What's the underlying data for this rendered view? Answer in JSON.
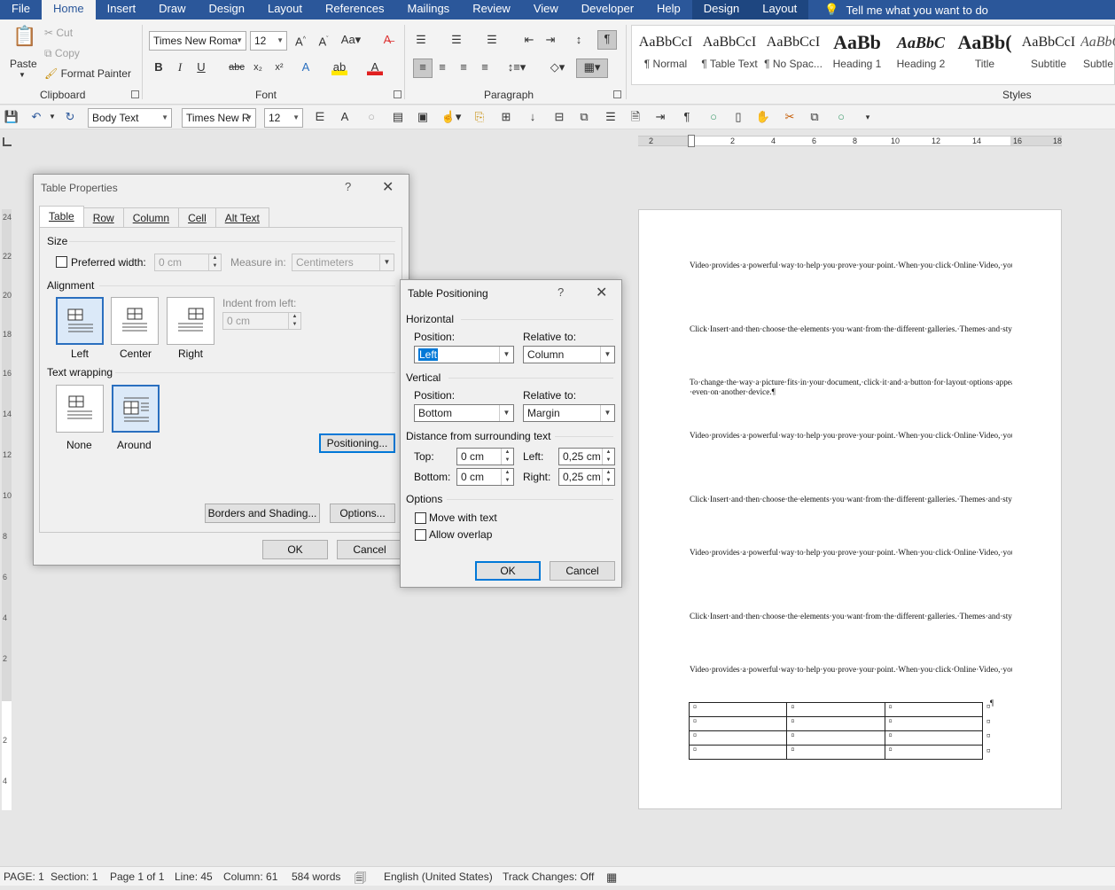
{
  "ribbon_tabs": [
    "File",
    "Home",
    "Insert",
    "Draw",
    "Design",
    "Layout",
    "References",
    "Mailings",
    "Review",
    "View",
    "Developer",
    "Help",
    "Design",
    "Layout"
  ],
  "tell_me": "Tell me what you want to do",
  "clipboard": {
    "paste": "Paste",
    "cut": "Cut",
    "copy": "Copy",
    "format_painter": "Format Painter",
    "label": "Clipboard"
  },
  "font": {
    "name": "Times New Roma",
    "size": "12",
    "label": "Font"
  },
  "paragraph": {
    "label": "Paragraph"
  },
  "styles": {
    "label": "Styles",
    "items": [
      {
        "sample": "AaBbCcI",
        "name": "¶ Normal"
      },
      {
        "sample": "AaBbCcI",
        "name": "¶ Table Text"
      },
      {
        "sample": "AaBbCcI",
        "name": "¶ No Spac..."
      },
      {
        "sample": "AaBb",
        "name": "Heading 1"
      },
      {
        "sample": "AaBbC",
        "name": "Heading 2"
      },
      {
        "sample": "AaBb(",
        "name": "Title"
      },
      {
        "sample": "AaBbCcI",
        "name": "Subtitle"
      },
      {
        "sample": "AaBbCcI",
        "name": "Subtle"
      }
    ]
  },
  "qat": {
    "style": "Body Text",
    "font": "Times New R",
    "size": "12"
  },
  "hruler": [
    "2",
    "2",
    "4",
    "6",
    "8",
    "10",
    "12",
    "14",
    "16",
    "18"
  ],
  "vruler": [
    "24",
    "22",
    "20",
    "18",
    "16",
    "14",
    "12",
    "10",
    "8",
    "6",
    "4",
    "2",
    "2",
    "4"
  ],
  "table_properties": {
    "title": "Table Properties",
    "help": "?",
    "tabs": [
      "Table",
      "Row",
      "Column",
      "Cell",
      "Alt Text"
    ],
    "size_label": "Size",
    "preferred_width_label": "Preferred width:",
    "preferred_width_value": "0 cm",
    "measure_in_label": "Measure in:",
    "measure_in_value": "Centimeters",
    "alignment_label": "Alignment",
    "align_left": "Left",
    "align_center": "Center",
    "align_right": "Right",
    "indent_label": "Indent from left:",
    "indent_value": "0 cm",
    "wrapping_label": "Text wrapping",
    "wrap_none": "None",
    "wrap_around": "Around",
    "positioning_btn": "Positioning...",
    "borders_btn": "Borders and Shading...",
    "options_btn": "Options...",
    "ok": "OK",
    "cancel": "Cancel"
  },
  "table_positioning": {
    "title": "Table Positioning",
    "help": "?",
    "horizontal_label": "Horizontal",
    "h_position_label": "Position:",
    "h_position_value": "Left",
    "h_relative_label": "Relative to:",
    "h_relative_value": "Column",
    "vertical_label": "Vertical",
    "v_position_label": "Position:",
    "v_position_value": "Bottom",
    "v_relative_label": "Relative to:",
    "v_relative_value": "Margin",
    "distance_label": "Distance from surrounding text",
    "top_label": "Top:",
    "top_value": "0 cm",
    "bottom_label": "Bottom:",
    "bottom_value": "0 cm",
    "left_label": "Left:",
    "left_value": "0,25 cm",
    "right_label": "Right:",
    "right_value": "0,25 cm",
    "options_label": "Options",
    "move_with_text": "Move with text",
    "allow_overlap": "Allow overlap",
    "move_with_text_checked": false,
    "allow_overlap_checked": false,
    "ok": "OK",
    "cancel": "Cancel"
  },
  "document": {
    "paragraphs": [
      "Video·provides·a·powerful·way·to·help·you·prove·your·point.·When·you·click·Online·Video,·you·can·paste·in·the·embed·code·for·the·video·you·want·to·add.·You·can·also·type·a·keyword·to·search·online·for·the·video·that·best·fits·your·document.·To·make·your·document·look·professionally·produced,·Word·provides·header,·footer,·cover·page,·and·text·box·designs·that·complement·each·other.·For·example,·you·can·add·a·matching·cover·page,·header,·and·sidebar.¶",
      "Click·Insert·and·then·choose·the·elements·you·want·from·the·different·galleries.·Themes·and·styles·also·help·keep·your·document·coordinated.·When·you·click·Design·and·choose·a·new·Theme,·the·pictures,·charts,·and·SmartArt·graphics·change·to·match·your·new·theme.·When·you·apply·styles,·your·headings·change·to·match·the·new·theme.·Save·time·in·Word·with·new·buttons·that·show·up·where·you·need·them.¶",
      "To·change·the·way·a·picture·fits·in·your·document,·click·it·and·a·button·for·layout·options·appears·next·to·it.·When·you·work·on·a·table,·click·where·you·want·to·add·a·row·or·a·column,·and·then·click·the·plus·sign.·Reading·is·easier,·too,·in·the·new·Reading·view.·You·can·collapse·parts·of·the·document·and·focus·on·the·text·you·want.·If·you·need·to·stop·reading·before·you·reach·the·end,·Word·remembers·where·you·left·off·-·even·on·another·device.¶",
      "Video·provides·a·powerful·way·to·help·you·prove·your·point.·When·you·click·Online·Video,·you·can·paste·in·the·embed·code·for·the·video·you·want·to·add.·You·can·also·type·a·keyword·to·search·online·for·the·video·that·best·fits·your·document.·To·make·your·document·look·professionally·produced,·Word·provides·header,·footer,·cover·page,·and·text·box·designs·that·complement·each·other.·For·example,·you·can·add·a·matching·cover·page,·header,·and·sidebar.¶",
      "Click·Insert·and·then·choose·the·elements·you·want·from·the·different·galleries.·Themes·and·styles·also·help·keep·your·document·coordinated.·When·you·click·Design·and·choose·a·new·Theme,·the·pictures,·charts,·and·SmartArt·graphics·change·to·match·your·new·theme.·When·you·apply·styles,·your·headings·change·to·match·the·new·theme.·Save·time·in·Word·with·new·buttons·that·show·up·where·you·need·them.¶",
      "Video·provides·a·powerful·way·to·help·you·prove·your·point.·When·you·click·Online·Video,·you·can·paste·in·the·embed·code·for·the·video·you·want·to·add.·You·can·also·type·a·keyword·to·search·online·for·the·video·that·best·fits·your·document.·To·make·your·document·look·professionally·produced,·Word·provides·header,·footer,·cover·page,·and·text·box·designs·that·complement·each·other.·For·example,·you·can·add·a·matching·cover·page,·header,·and·sidebar.¶",
      "Click·Insert·and·then·choose·the·elements·you·want·from·the·different·galleries.·Themes·and·styles·also·help·keep·your·document·coordinated.·When·you·click·Design·and·choose·a·new·Theme,·the·pictures,·charts,·and·SmartArt·graphics·change·to·match·your·new·theme.·When·you·apply·styles,·your·headings·change·to·match·the·new·theme.·Save·time·in·Word·with·new·buttons·that·show·up·where·you·need·them.¶",
      "Video·provides·a·powerful·way·to·help·you·prove·your·point.·When·you·click·Online·Video,·you·can·paste·in·the·embed·code·for·the·video·you·want·to·add.·You·can·also·type·a·keyword·to·search·online·for·the·video·that·best·fits·your·document.¶"
    ],
    "cell_mark": "¤",
    "para_mark": "¶",
    "table_rows": 4,
    "table_cols": 3
  },
  "status": {
    "page": "PAGE: 1",
    "section": "Section: 1",
    "page_of": "Page 1 of 1",
    "line": "Line: 45",
    "column": "Column: 61",
    "words": "584 words",
    "language": "English (United States)",
    "track": "Track Changes: Off"
  },
  "colors": {
    "accent": "#2b579a",
    "selection": "#0078d7"
  }
}
